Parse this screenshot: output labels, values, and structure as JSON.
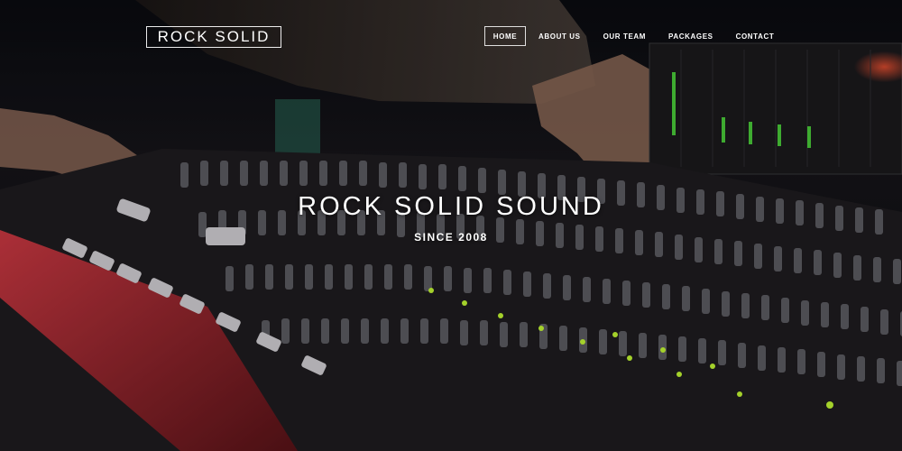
{
  "brand": {
    "logo_text": "ROCK SOLID"
  },
  "nav": {
    "items": [
      {
        "label": "HOME",
        "active": true
      },
      {
        "label": "ABOUT US",
        "active": false
      },
      {
        "label": "OUR TEAM",
        "active": false
      },
      {
        "label": "PACKAGES",
        "active": false
      },
      {
        "label": "CONTACT",
        "active": false
      }
    ]
  },
  "hero": {
    "title": "ROCK SOLID SOUND",
    "subtitle": "SINCE 2008",
    "background_image": "audio mixing console with hands adjusting faders"
  },
  "colors": {
    "text": "#ffffff",
    "console_red": "#c0303a",
    "led_green": "#7cff3a"
  }
}
